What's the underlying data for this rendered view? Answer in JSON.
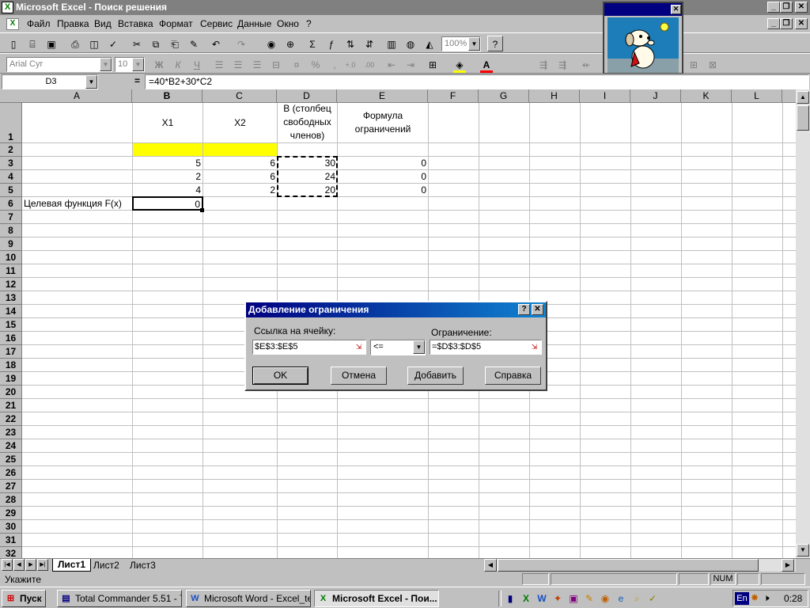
{
  "window": {
    "title": "Microsoft Excel - Поиск решения"
  },
  "menu": [
    "Файл",
    "Правка",
    "Вид",
    "Вставка",
    "Формат",
    "Сервис",
    "Данные",
    "Окно",
    "?"
  ],
  "toolbar": {
    "zoom": "100%"
  },
  "format_toolbar": {
    "font": "Arial Cyr",
    "size": "10",
    "bold": "Ж",
    "italic": "К",
    "underline": "Ч",
    "percent": "%",
    "thousands": ","
  },
  "formula_bar": {
    "name_box": "D3",
    "equals": "=",
    "formula": "=40*B2+30*C2"
  },
  "columns": [
    "A",
    "B",
    "C",
    "D",
    "E",
    "F",
    "G",
    "H",
    "I",
    "J",
    "K",
    "L"
  ],
  "rows": [
    "1",
    "2",
    "3",
    "4",
    "5",
    "6",
    "7",
    "8",
    "9",
    "10",
    "11",
    "12",
    "13",
    "14",
    "15",
    "16",
    "17",
    "18",
    "19",
    "20",
    "21",
    "22",
    "23",
    "24",
    "25",
    "26",
    "27",
    "28",
    "29",
    "30",
    "31",
    "32"
  ],
  "cells": {
    "B1": "X1",
    "C1": "X2",
    "D1": "B (столбец свободных членов)",
    "E1": "Формула ограничений",
    "B3": "5",
    "C3": "6",
    "D3": "30",
    "E3": "0",
    "B4": "2",
    "C4": "6",
    "D4": "24",
    "E4": "0",
    "B5": "4",
    "C5": "2",
    "D5": "20",
    "E5": "0",
    "A6": "Целевая функция F(x)",
    "B6": "0"
  },
  "dialog": {
    "title": "Добавление ограничения",
    "help_glyph": "?",
    "close_glyph": "✕",
    "cell_ref_label": "Ссылка на ячейку:",
    "cell_ref_value": "$E$3:$E$5",
    "operator": "<=",
    "constraint_label": "Ограничение:",
    "constraint_value": "=$D$3:$D$5",
    "ok": "OK",
    "cancel": "Отмена",
    "add": "Добавить",
    "help": "Справка"
  },
  "sheet_tabs": [
    "Лист1",
    "Лист2",
    "Лист3"
  ],
  "status": {
    "text": "Укажите",
    "num": "NUM"
  },
  "taskbar": {
    "start": "Пуск",
    "tasks": [
      "Total Commander 5.51 - 777",
      "Microsoft Word - Excel_te...",
      "Microsoft Excel - Пои..."
    ],
    "lang": "En",
    "clock": "0:28"
  },
  "colors": {
    "highlight": "#ffff00",
    "title_inactive": "#808080",
    "dialog_title": "#000080"
  }
}
